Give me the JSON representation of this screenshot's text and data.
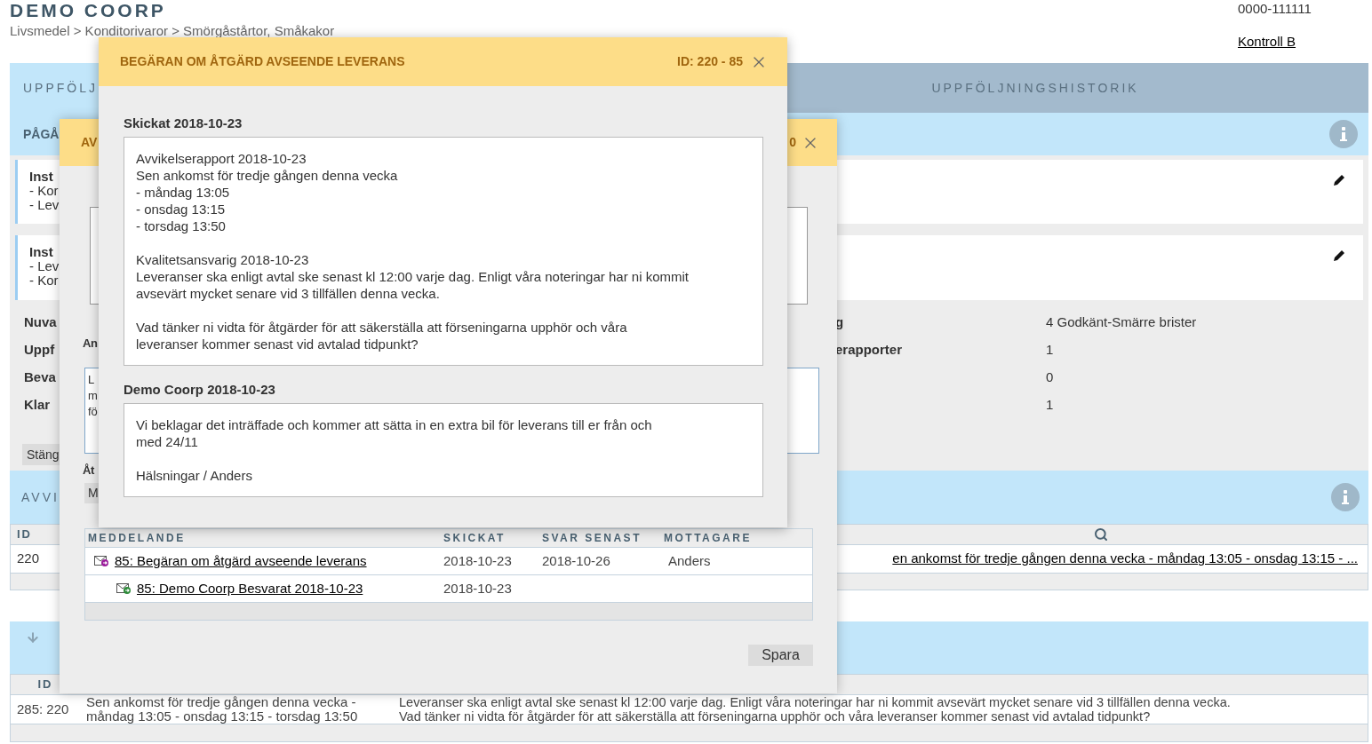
{
  "header": {
    "company": "DEMO COORP",
    "breadcrumb": "Livsmedel > Konditorivaror > Smörgåstårtor, Småkakor",
    "phone": "0000-111111",
    "user_link": "Kontroll B"
  },
  "tabs": [
    {
      "label": "UPPFÖLJ",
      "selected": true
    },
    {
      "label": "UPPFÖLJNINGSHISTORIK",
      "selected": false
    }
  ],
  "ongoing": {
    "title": "PÅGÅ",
    "cards": [
      {
        "lines": [
          "Inst",
          "- Kor",
          "- Lev"
        ]
      },
      {
        "lines": [
          "Inst",
          "- Lev",
          "- Kor"
        ]
      }
    ],
    "fields": [
      {
        "label": "Nuva",
        "label_tail": "g",
        "value": "4 Godkänt-Smärre brister"
      },
      {
        "label": "Uppf",
        "label_tail": "erapporter",
        "value": "1"
      },
      {
        "label": "Beva",
        "value": "0"
      },
      {
        "label": "Klar",
        "value": "1"
      }
    ],
    "close_button": "Stäng"
  },
  "deviations": {
    "title": "AVVI",
    "columns": [
      "ID"
    ],
    "rows": [
      {
        "id": "220",
        "text": "en ankomst för tredje gången denna vecka - måndag 13:05 - onsdag 13:15 - ..."
      }
    ]
  },
  "followups": {
    "columns": [
      "ID"
    ],
    "rows": [
      {
        "id": "285: 220",
        "summary": [
          "Sen ankomst för tredje gången denna vecka -",
          "måndag 13:05 - onsdag 13:15 - torsdag 13:50"
        ],
        "message": [
          "Leveranser ska enligt avtal ske senast kl 12:00 varje dag. Enligt våra noteringar har ni kommit avsevärt mycket senare vid 3 tillfällen denna vecka.",
          "Vad tänker ni vidta för åtgärder för att säkerställa att förseningarna upphör och våra leveranser kommer senast vid avtalad tidpunkt?"
        ]
      }
    ]
  },
  "back_dialog": {
    "title": "AV",
    "id_tail": "0",
    "label_1": "An",
    "textarea_lines": [
      "L",
      "m",
      "fö"
    ],
    "label_2": "Åt",
    "button": "M",
    "messages": {
      "columns": [
        "MEDDELANDE",
        "SKICKAT",
        "SVAR SENAST",
        "MOTTAGARE"
      ],
      "rows": [
        {
          "kind": "sent",
          "subject": "85: Begäran om åtgärd avseende leverans",
          "sent": "2018-10-23",
          "reply_by": "2018-10-26",
          "recipient": "Anders"
        },
        {
          "kind": "reply",
          "subject": "85: Demo Coorp Besvarat 2018-10-23",
          "sent": "2018-10-23"
        }
      ]
    },
    "save_button": "Spara"
  },
  "dialog": {
    "title": "BEGÄRAN OM ÅTGÄRD AVSEENDE LEVERANS",
    "id": "ID: 220 - 85",
    "sections": [
      {
        "heading": "Skickat 2018-10-23",
        "paragraphs": [
          [
            "Avvikelserapport 2018-10-23",
            "Sen ankomst för tredje gången denna vecka",
            "- måndag 13:05",
            "- onsdag 13:15",
            "- torsdag 13:50"
          ],
          [
            "Kvalitetsansvarig 2018-10-23",
            "Leveranser ska enligt avtal ske senast kl 12:00 varje dag. Enligt våra noteringar har ni kommit",
            "avsevärt mycket senare vid 3 tillfällen denna vecka."
          ],
          [
            "Vad tänker ni vidta för åtgärder för att säkerställa att förseningarna upphör och våra",
            "leveranser kommer senast vid avtalad tidpunkt?"
          ]
        ]
      },
      {
        "heading": "Demo Coorp 2018-10-23",
        "paragraphs": [
          [
            "Vi beklagar det inträffade och kommer att sätta in en extra bil för leverans till er från och",
            "med 24/11"
          ],
          [
            "Hälsningar / Anders"
          ]
        ]
      }
    ]
  }
}
